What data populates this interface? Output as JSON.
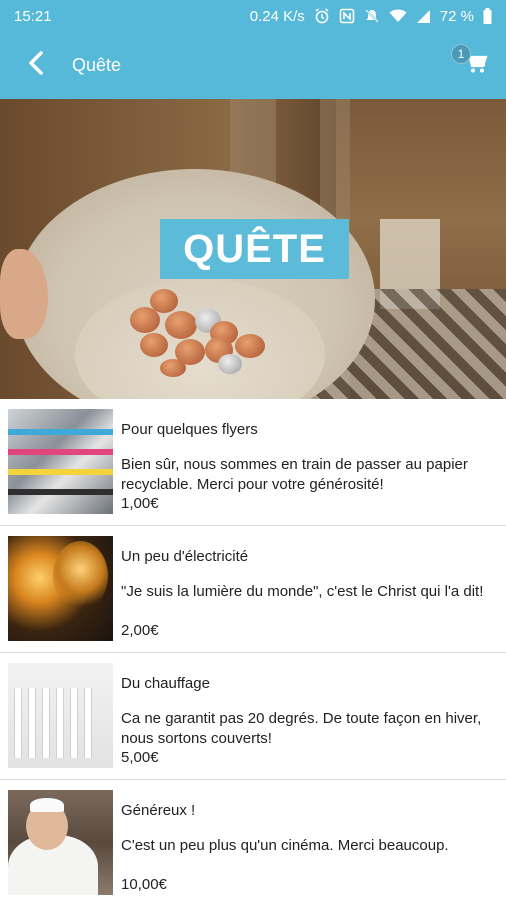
{
  "status_bar": {
    "time": "15:21",
    "network_speed": "0.24 K/s",
    "battery": "72 %",
    "icons": [
      "alarm-icon",
      "nfc-icon",
      "mute-icon",
      "wifi-icon",
      "signal-icon",
      "battery-icon"
    ]
  },
  "app_bar": {
    "title": "Quête",
    "back_icon": "back-arrow-icon",
    "cart_icon": "cart-icon",
    "cart_count": "1"
  },
  "hero": {
    "label": "QUÊTE"
  },
  "items": [
    {
      "name": "Pour quelques flyers",
      "description": "Bien sûr, nous sommes en train de passer au papier recyclable. Merci pour votre générosité!",
      "price": "1,00€"
    },
    {
      "name": "Un peu d'électricité",
      "description": "\"Je suis la lumière du monde\", c'est le Christ qui l'a dit!",
      "price": "2,00€"
    },
    {
      "name": "Du chauffage",
      "description": "Ca ne garantit pas 20 degrés. De toute façon en hiver, nous sortons couverts!",
      "price": "5,00€"
    },
    {
      "name": "Généreux !",
      "description": "C'est un peu plus qu'un cinéma. Merci beaucoup.",
      "price": "10,00€"
    }
  ],
  "colors": {
    "primary": "#56b9d9",
    "hero_label_bg": "#5bbbd8",
    "divider": "#dcdcdc"
  }
}
